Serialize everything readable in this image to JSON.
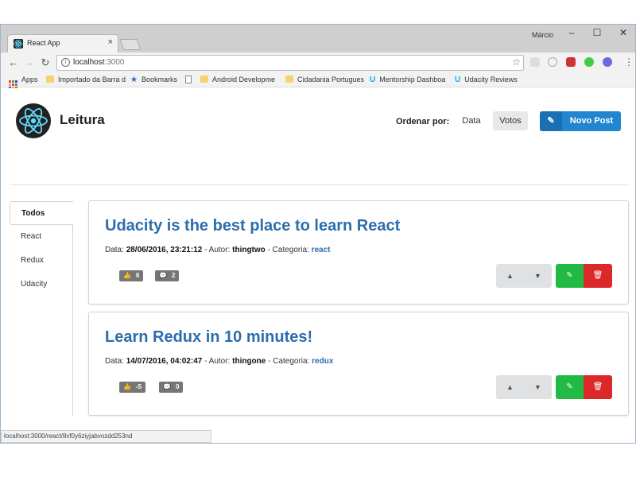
{
  "browser": {
    "tab_title": "React App",
    "tab_close": "×",
    "user_name": "Márcio",
    "controls": {
      "minimize": "–",
      "maximize": "☐",
      "close": "✕"
    },
    "url_host": "localhost",
    "url_port": ":3000",
    "status_url": "localhost:3000/react/8xf0y6ziyjabvozdd253nd"
  },
  "bookmarks": [
    {
      "label": "Apps",
      "icon": "apps-icon"
    },
    {
      "label": "Importado da Barra d",
      "icon": "folder-icon"
    },
    {
      "label": "Bookmarks",
      "icon": "star-icon"
    },
    {
      "label": "",
      "icon": "page-icon"
    },
    {
      "label": "Android Developme",
      "icon": "folder-icon"
    },
    {
      "label": "Cidadania Portugues",
      "icon": "folder-icon"
    },
    {
      "label": "Mentorship Dashboa",
      "icon": "udacity-icon"
    },
    {
      "label": "Udacity Reviews",
      "icon": "udacity-icon"
    }
  ],
  "header": {
    "app_title": "Leitura",
    "sort_label": "Ordenar por:",
    "sort_options": [
      "Data",
      "Votos"
    ],
    "sort_selected": "Votos",
    "new_post_label": "Novo Post"
  },
  "sidebar": {
    "items": [
      {
        "label": "Todos",
        "active": true
      },
      {
        "label": "React",
        "active": false
      },
      {
        "label": "Redux",
        "active": false
      },
      {
        "label": "Udacity",
        "active": false
      }
    ]
  },
  "posts": [
    {
      "title": "Udacity is the best place to learn React",
      "data_label": "Data:",
      "date": "28/06/2016, 23:21:12",
      "author_label": " - Autor:",
      "author": "thingtwo",
      "category_label": " - Categoria:",
      "category": "react",
      "votes": "6",
      "comments": "2"
    },
    {
      "title": "Learn Redux in 10 minutes!",
      "data_label": "Data:",
      "date": "14/07/2016, 04:02:47",
      "author_label": " - Autor:",
      "author": "thingone",
      "category_label": " - Categoria:",
      "category": "redux",
      "votes": "-5",
      "comments": "0"
    }
  ],
  "colors": {
    "primary": "#2185d0",
    "edit": "#21ba45",
    "delete": "#db2828",
    "title": "#2b6dad",
    "badge": "#767676"
  }
}
